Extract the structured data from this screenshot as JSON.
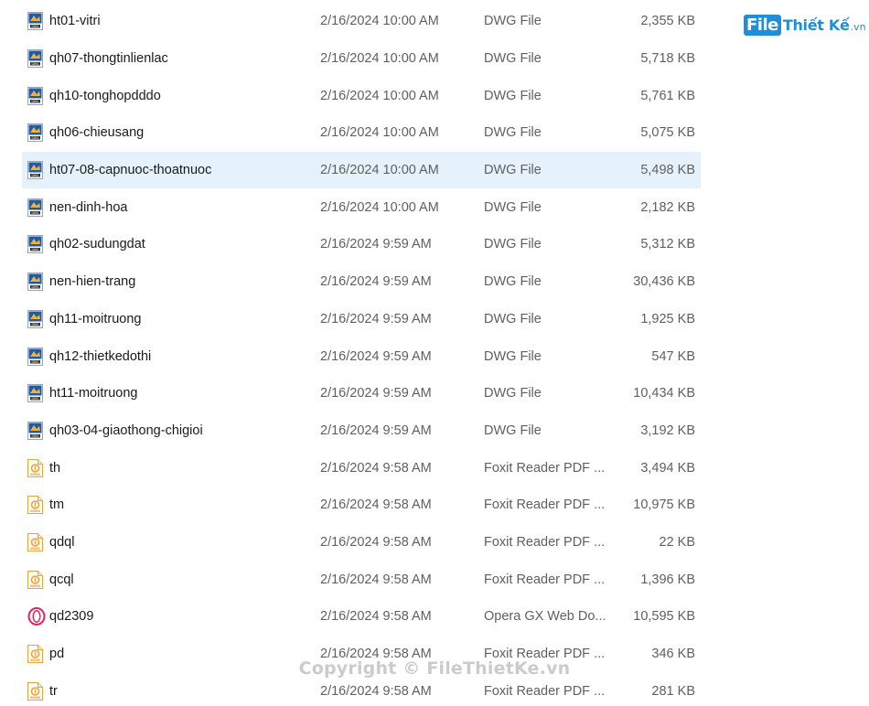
{
  "logo": {
    "file": "File",
    "rest": "Thiết Kế",
    "vn": ".vn"
  },
  "watermark": "Copyright © FileThietKe.vn",
  "colors": {
    "selection": "#e5f1fb",
    "dwg_icon_blue": "#1f5aa6",
    "pdf_icon_orange": "#e8a33a",
    "opera_icon": "#e0245e",
    "logo_blue": "#1e8fd8"
  },
  "files": [
    {
      "name": "ht01-vitri",
      "date": "2/16/2024 10:00 AM",
      "type": "DWG File",
      "size": "2,355 KB",
      "icon": "dwg-icon",
      "selected": false
    },
    {
      "name": "qh07-thongtinlienlac",
      "date": "2/16/2024 10:00 AM",
      "type": "DWG File",
      "size": "5,718 KB",
      "icon": "dwg-icon",
      "selected": false
    },
    {
      "name": "qh10-tonghopdddo",
      "date": "2/16/2024 10:00 AM",
      "type": "DWG File",
      "size": "5,761 KB",
      "icon": "dwg-icon",
      "selected": false
    },
    {
      "name": "qh06-chieusang",
      "date": "2/16/2024 10:00 AM",
      "type": "DWG File",
      "size": "5,075 KB",
      "icon": "dwg-icon",
      "selected": false
    },
    {
      "name": "ht07-08-capnuoc-thoatnuoc",
      "date": "2/16/2024 10:00 AM",
      "type": "DWG File",
      "size": "5,498 KB",
      "icon": "dwg-icon",
      "selected": true
    },
    {
      "name": "nen-dinh-hoa",
      "date": "2/16/2024 10:00 AM",
      "type": "DWG File",
      "size": "2,182 KB",
      "icon": "dwg-icon",
      "selected": false
    },
    {
      "name": "qh02-sudungdat",
      "date": "2/16/2024 9:59 AM",
      "type": "DWG File",
      "size": "5,312 KB",
      "icon": "dwg-icon",
      "selected": false
    },
    {
      "name": "nen-hien-trang",
      "date": "2/16/2024 9:59 AM",
      "type": "DWG File",
      "size": "30,436 KB",
      "icon": "dwg-icon",
      "selected": false
    },
    {
      "name": "qh11-moitruong",
      "date": "2/16/2024 9:59 AM",
      "type": "DWG File",
      "size": "1,925 KB",
      "icon": "dwg-icon",
      "selected": false
    },
    {
      "name": "qh12-thietkedothi",
      "date": "2/16/2024 9:59 AM",
      "type": "DWG File",
      "size": "547 KB",
      "icon": "dwg-icon",
      "selected": false
    },
    {
      "name": "ht11-moitruong",
      "date": "2/16/2024 9:59 AM",
      "type": "DWG File",
      "size": "10,434 KB",
      "icon": "dwg-icon",
      "selected": false
    },
    {
      "name": "qh03-04-giaothong-chigioi",
      "date": "2/16/2024 9:59 AM",
      "type": "DWG File",
      "size": "3,192 KB",
      "icon": "dwg-icon",
      "selected": false
    },
    {
      "name": "th",
      "date": "2/16/2024 9:58 AM",
      "type": "Foxit Reader PDF ...",
      "size": "3,494 KB",
      "icon": "pdf-icon",
      "selected": false
    },
    {
      "name": "tm",
      "date": "2/16/2024 9:58 AM",
      "type": "Foxit Reader PDF ...",
      "size": "10,975 KB",
      "icon": "pdf-icon",
      "selected": false
    },
    {
      "name": "qdql",
      "date": "2/16/2024 9:58 AM",
      "type": "Foxit Reader PDF ...",
      "size": "22 KB",
      "icon": "pdf-icon",
      "selected": false
    },
    {
      "name": "qcql",
      "date": "2/16/2024 9:58 AM",
      "type": "Foxit Reader PDF ...",
      "size": "1,396 KB",
      "icon": "pdf-icon",
      "selected": false
    },
    {
      "name": "qd2309",
      "date": "2/16/2024 9:58 AM",
      "type": "Opera GX Web Do...",
      "size": "10,595 KB",
      "icon": "opera-icon",
      "selected": false
    },
    {
      "name": "pd",
      "date": "2/16/2024 9:58 AM",
      "type": "Foxit Reader PDF ...",
      "size": "346 KB",
      "icon": "pdf-icon",
      "selected": false
    },
    {
      "name": "tr",
      "date": "2/16/2024 9:58 AM",
      "type": "Foxit Reader PDF ...",
      "size": "281 KB",
      "icon": "pdf-icon",
      "selected": false
    }
  ]
}
